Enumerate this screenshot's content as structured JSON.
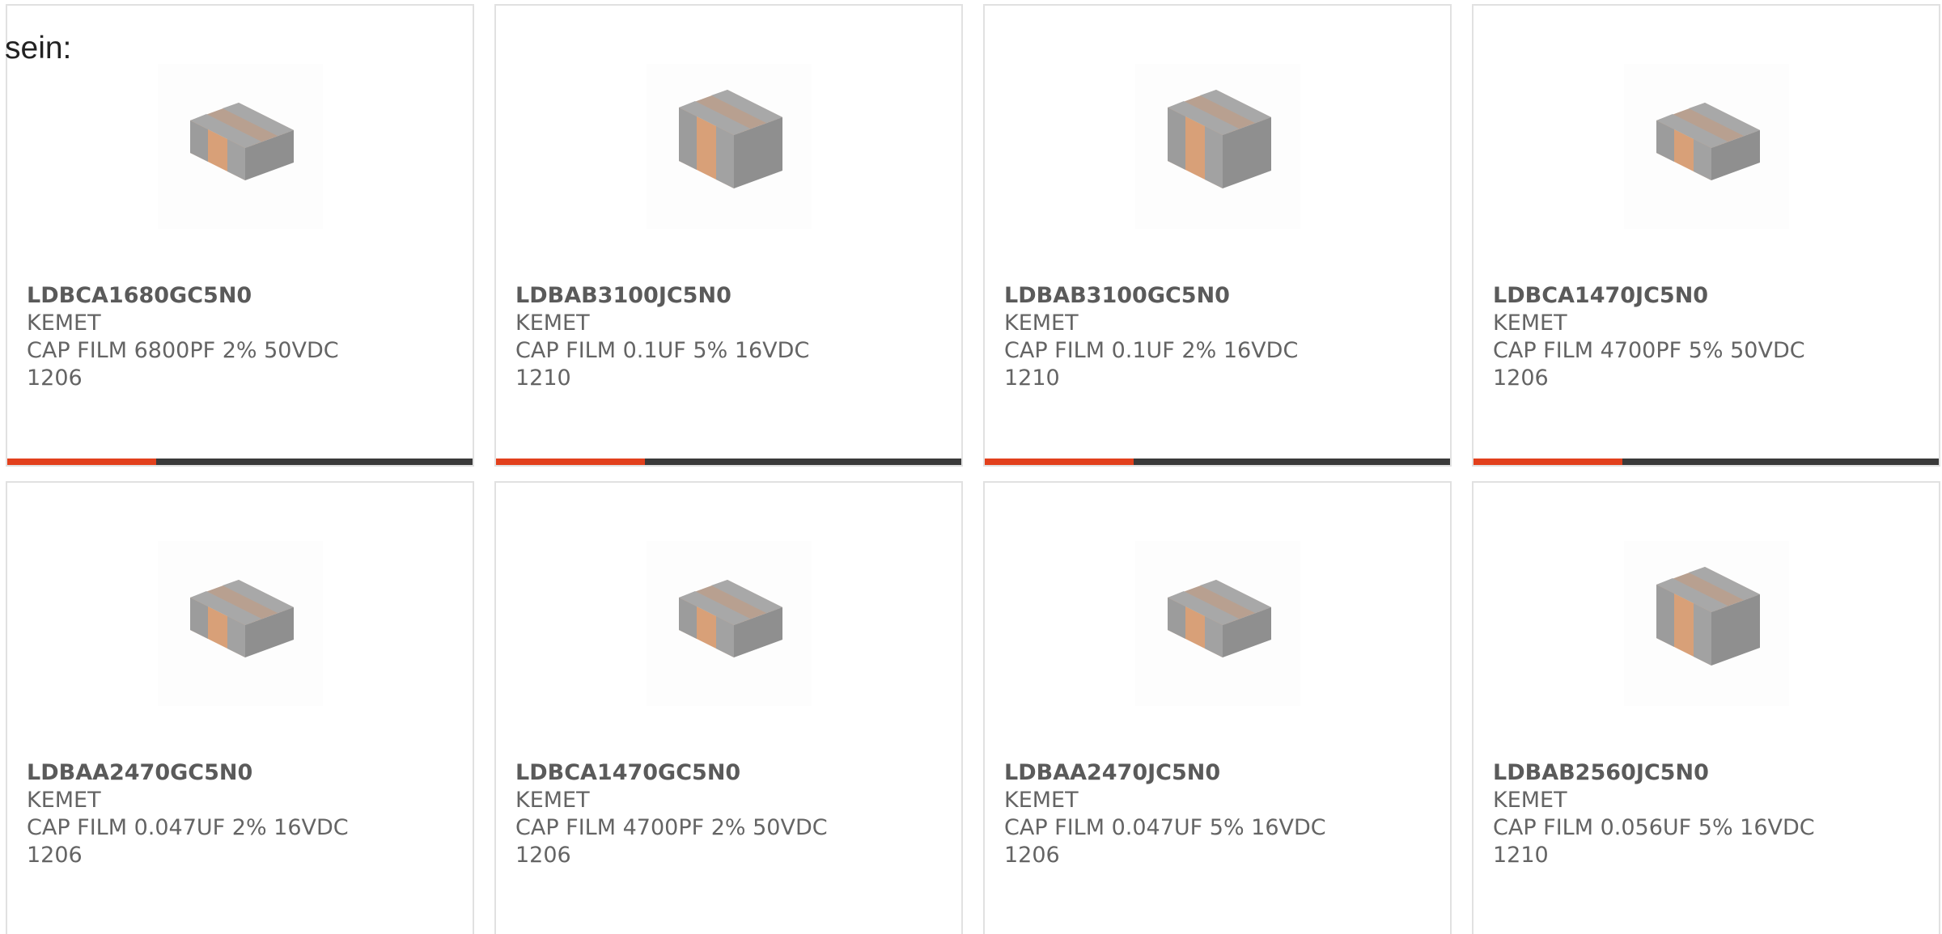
{
  "lead_text": "sein:",
  "colors": {
    "card_border": "#e1e1e1",
    "text_gray": "#646464",
    "accent_orange": "#e2401c",
    "bar_dark": "#3a3a3a"
  },
  "products": [
    {
      "part_number": "LDBCA1680GC5N0",
      "manufacturer": "KEMET",
      "description_line1": "CAP FILM 6800PF 2% 50VDC",
      "description_line2": "1206",
      "image_icon": "capacitor-1206-icon",
      "progress": 0.32
    },
    {
      "part_number": "LDBAB3100JC5N0",
      "manufacturer": "KEMET",
      "description_line1": "CAP FILM 0.1UF 5% 16VDC 1210",
      "description_line2": "",
      "image_icon": "capacitor-1210-icon",
      "progress": 0.32
    },
    {
      "part_number": "LDBAB3100GC5N0",
      "manufacturer": "KEMET",
      "description_line1": "CAP FILM 0.1UF 2% 16VDC 1210",
      "description_line2": "",
      "image_icon": "capacitor-1210-icon",
      "progress": 0.32
    },
    {
      "part_number": "LDBCA1470JC5N0",
      "manufacturer": "KEMET",
      "description_line1": "CAP FILM 4700PF 5% 50VDC",
      "description_line2": "1206",
      "image_icon": "capacitor-1206-icon",
      "progress": 0.32
    },
    {
      "part_number": "LDBAA2470GC5N0",
      "manufacturer": "KEMET",
      "description_line1": "CAP FILM 0.047UF 2% 16VDC",
      "description_line2": "1206",
      "image_icon": "capacitor-1206-icon"
    },
    {
      "part_number": "LDBCA1470GC5N0",
      "manufacturer": "KEMET",
      "description_line1": "CAP FILM 4700PF 2% 50VDC",
      "description_line2": "1206",
      "image_icon": "capacitor-1206-icon"
    },
    {
      "part_number": "LDBAA2470JC5N0",
      "manufacturer": "KEMET",
      "description_line1": "CAP FILM 0.047UF 5% 16VDC",
      "description_line2": "1206",
      "image_icon": "capacitor-1206-icon"
    },
    {
      "part_number": "LDBAB2560JC5N0",
      "manufacturer": "KEMET",
      "description_line1": "CAP FILM 0.056UF 5% 16VDC",
      "description_line2": "1210",
      "image_icon": "capacitor-1210-icon"
    }
  ]
}
